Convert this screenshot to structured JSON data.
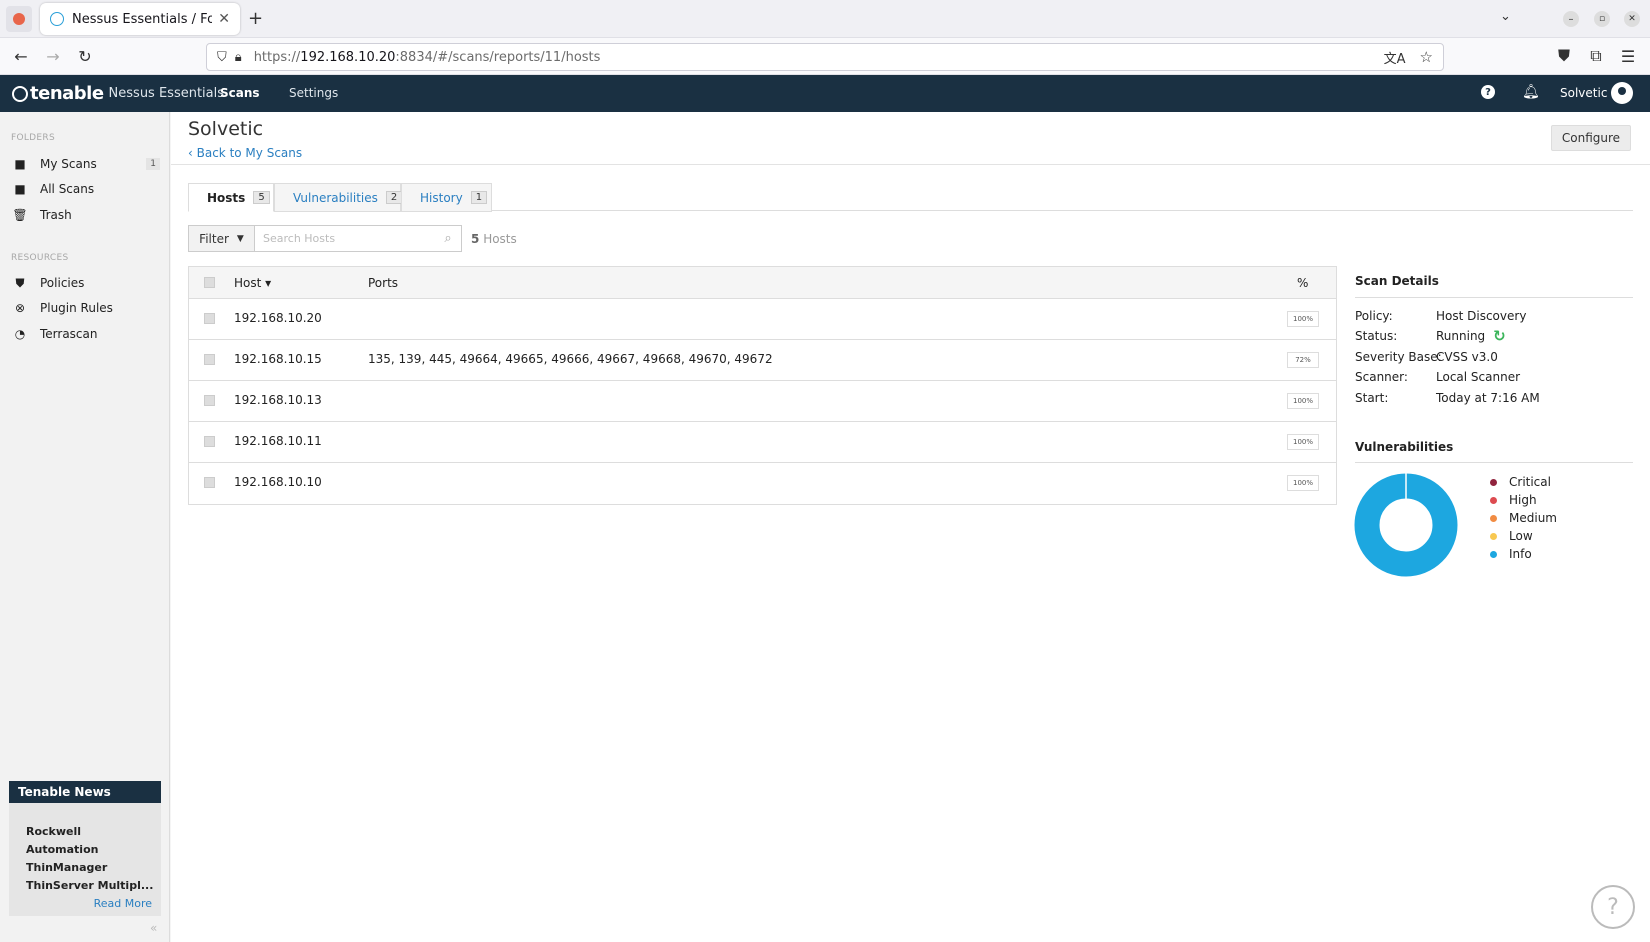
{
  "browser": {
    "tab_title": "Nessus Essentials / Folde",
    "url_scheme": "https://",
    "url_host": "192.168.10.20",
    "url_path": ":8834/#/scans/reports/11/hosts"
  },
  "header": {
    "brand": "tenable",
    "product": "Nessus Essentials",
    "nav": [
      "Scans",
      "Settings"
    ],
    "user": "Solvetic"
  },
  "sidebar": {
    "folders_heading": "FOLDERS",
    "folders": [
      {
        "label": "My Scans",
        "count": "1",
        "icon": "folder-icon"
      },
      {
        "label": "All Scans",
        "icon": "folder-icon"
      },
      {
        "label": "Trash",
        "icon": "trash-icon"
      }
    ],
    "resources_heading": "RESOURCES",
    "resources": [
      {
        "label": "Policies",
        "icon": "shield-icon"
      },
      {
        "label": "Plugin Rules",
        "icon": "plugin-icon"
      },
      {
        "label": "Terrascan",
        "icon": "terrascan-icon"
      }
    ],
    "news": {
      "title": "Tenable News",
      "headline": "Rockwell Automation ThinManager ThinServer Multipl...",
      "read_more": "Read More"
    },
    "collapse": "«"
  },
  "page": {
    "title": "Solvetic",
    "back_link": "Back to My Scans",
    "configure": "Configure"
  },
  "tabs": [
    {
      "label": "Hosts",
      "count": "5"
    },
    {
      "label": "Vulnerabilities",
      "count": "2"
    },
    {
      "label": "History",
      "count": "1"
    }
  ],
  "filter": {
    "button": "Filter",
    "placeholder": "Search Hosts",
    "count": "5",
    "count_suffix": "Hosts"
  },
  "table": {
    "headers": [
      "Host ▾",
      "Ports",
      "%"
    ],
    "rows": [
      {
        "host": "192.168.10.20",
        "ports": "",
        "pct": "100%"
      },
      {
        "host": "192.168.10.15",
        "ports": "135, 139, 445, 49664, 49665, 49666, 49667, 49668, 49670, 49672",
        "pct": "72%"
      },
      {
        "host": "192.168.10.13",
        "ports": "",
        "pct": "100%"
      },
      {
        "host": "192.168.10.11",
        "ports": "",
        "pct": "100%"
      },
      {
        "host": "192.168.10.10",
        "ports": "",
        "pct": "100%"
      }
    ]
  },
  "scan_details": {
    "title": "Scan Details",
    "policy_label": "Policy:",
    "policy": "Host Discovery",
    "status_label": "Status:",
    "status": "Running",
    "severity_label": "Severity Base:",
    "severity": "CVSS v3.0",
    "scanner_label": "Scanner:",
    "scanner": "Local Scanner",
    "start_label": "Start:",
    "start": "Today at 7:16 AM"
  },
  "vulnerabilities": {
    "title": "Vulnerabilities",
    "legend": [
      {
        "label": "Critical",
        "color": "#91243e"
      },
      {
        "label": "High",
        "color": "#dd4b50"
      },
      {
        "label": "Medium",
        "color": "#f18c43"
      },
      {
        "label": "Low",
        "color": "#f8c851"
      },
      {
        "label": "Info",
        "color": "#1da7e0"
      }
    ]
  },
  "colors": {
    "header_bg": "#1a3042",
    "link": "#2a7fc1",
    "donut_info": "#1da7e0",
    "running_icon": "#3bb55b"
  }
}
